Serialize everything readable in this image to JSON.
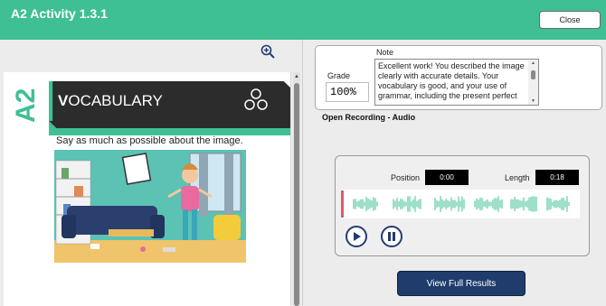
{
  "header": {
    "title": "A2 Activity 1.3.1",
    "close_label": "Close"
  },
  "toolbar": {
    "zoom_icon": "zoom-in-icon"
  },
  "page": {
    "level_badge": "A2",
    "section_prefix": "V",
    "section_rest": "OCABULARY",
    "instruction": "Say as much as possible about the image."
  },
  "grading": {
    "grade_label": "Grade",
    "grade_value": "100%",
    "note_label": "Note",
    "note_text": "Excellent work! You described the image clearly with accurate details. Your vocabulary is good, and your use of grammar, including the present perfect"
  },
  "recording": {
    "label": "Open Recording - Audio",
    "position_label": "Position",
    "position_value": "0:00",
    "length_label": "Length",
    "length_value": "0:18"
  },
  "actions": {
    "view_results_label": "View Full Results"
  },
  "colors": {
    "brand": "#3fbf94",
    "primary_button": "#1f3c6d",
    "waveform": "#3fbf94",
    "playhead": "#e05a66"
  }
}
